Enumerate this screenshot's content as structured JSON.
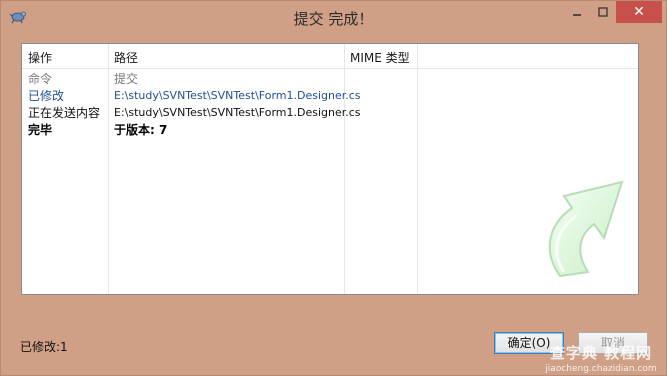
{
  "window": {
    "title": "提交 完成！",
    "close_glyph": "✕"
  },
  "columns": [
    {
      "label": "操作"
    },
    {
      "label": "路径"
    },
    {
      "label": "MIME 类型"
    }
  ],
  "rows": [
    {
      "action": "命令",
      "path": "提交",
      "style": "grey"
    },
    {
      "action": "已修改",
      "path": "E:\\study\\SVNTest\\SVNTest\\Form1.Designer.cs",
      "style": "blue"
    },
    {
      "action": "正在发送内容",
      "path": "E:\\study\\SVNTest\\SVNTest\\Form1.Designer.cs",
      "style": "black"
    },
    {
      "action": "完毕",
      "path": "于版本: 7",
      "style": "bold"
    }
  ],
  "status": {
    "text": "已修改:1"
  },
  "buttons": {
    "ok_label": "确定(O)",
    "cancel_label": "取消"
  },
  "watermark": {
    "title": "查字典 教程网",
    "url": "jiaocheng.chazidian.com"
  },
  "colors": {
    "window_bg": "#cf9f86",
    "close_bg": "#c7504a",
    "modified_text": "#1f4e9c",
    "command_text": "#7a7a7a"
  },
  "icons": {
    "app": "tortoise-icon",
    "decoration": "green-curved-arrow-icon"
  }
}
